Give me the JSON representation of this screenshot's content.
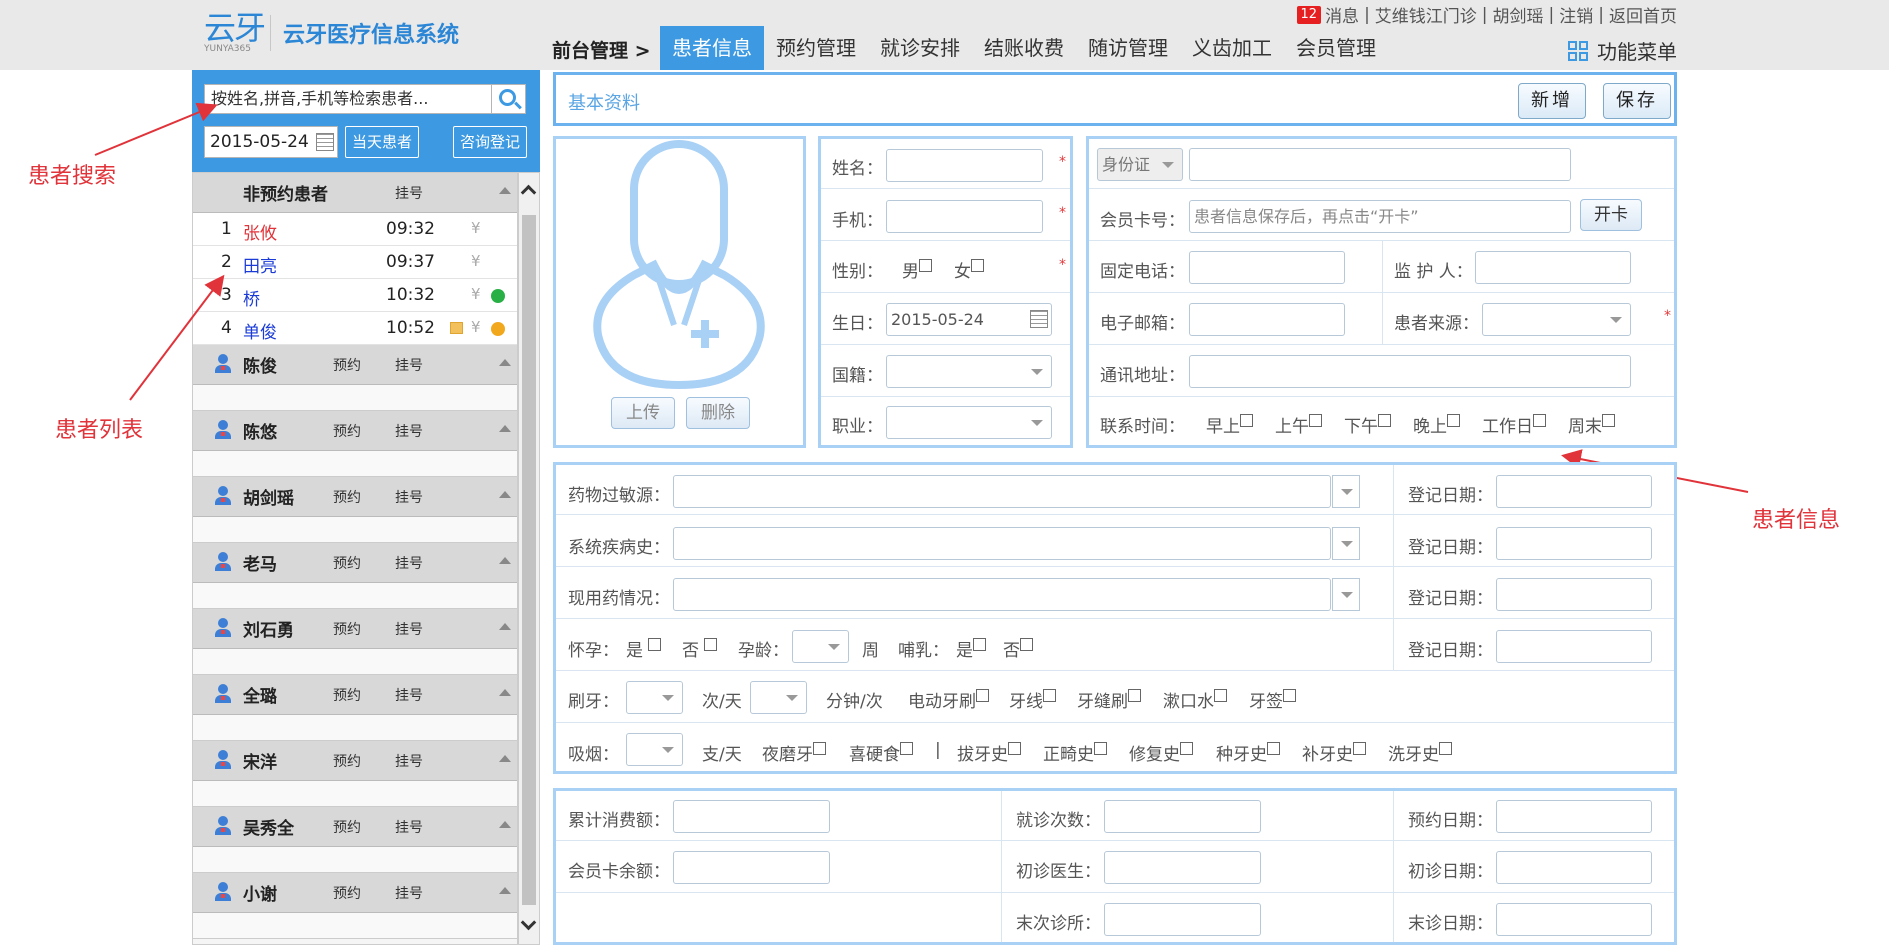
{
  "header": {
    "logo_glyph": "云牙",
    "logo_sub": "YUNYA365",
    "app_title": "云牙医疗信息系统",
    "msg_count": "12",
    "links": [
      "消息",
      "艾维钱江门诊",
      "胡剑瑶",
      "注销",
      "返回首页"
    ],
    "breadcrumb": "前台管理 >",
    "tabs": [
      "患者信息",
      "预约管理",
      "就诊安排",
      "结账收费",
      "随访管理",
      "义齿加工",
      "会员管理"
    ],
    "active_tab": "患者信息",
    "function_menu": "功能菜单"
  },
  "sidebar": {
    "search_placeholder": "按姓名,拼音,手机等检索患者...",
    "date": "2015-05-24",
    "btn_today": "当天患者",
    "btn_consult": "咨询登记",
    "nonappt_title": "非预约患者",
    "nonappt_tag": "挂号",
    "patients": [
      {
        "num": "1",
        "name": "张攸",
        "time": "09:32",
        "color": "#e0333a",
        "dot": ""
      },
      {
        "num": "2",
        "name": "田亮",
        "time": "09:37",
        "color": "#1a3bd6",
        "dot": ""
      },
      {
        "num": "3",
        "name": "桥",
        "time": "10:32",
        "color": "#1a3bd6",
        "dot": "#28b046"
      },
      {
        "num": "4",
        "name": "单俊",
        "time": "10:52",
        "color": "#1a3bd6",
        "dot": "#f2a81d"
      }
    ],
    "yen": "¥",
    "doctors": [
      "陈俊",
      "陈悠",
      "胡剑瑶",
      "老马",
      "刘石勇",
      "全璐",
      "宋洋",
      "吴秀全",
      "小谢"
    ],
    "tag_appt": "预约",
    "tag_reg": "挂号"
  },
  "annotations": {
    "search": "患者搜索",
    "list": "患者列表",
    "info": "患者信息"
  },
  "basic": {
    "title": "基本资料",
    "btn_new": "新增",
    "btn_save": "保存"
  },
  "photo": {
    "upload": "上传",
    "delete": "删除"
  },
  "personal": {
    "name": "姓名：",
    "phone": "手机：",
    "gender": "性别：",
    "male": "男",
    "female": "女",
    "birthday": "生日：",
    "birthday_value": "2015-05-24",
    "nationality": "国籍：",
    "occupation": "职业："
  },
  "contact": {
    "id_type": "身份证",
    "member_card": "会员卡号：",
    "member_card_placeholder": "患者信息保存后，再点击“开卡”",
    "open_card": "开卡",
    "landline": "固定电话：",
    "guardian": "监 护 人：",
    "email": "电子邮箱：",
    "source": "患者来源：",
    "address": "通讯地址：",
    "contact_time": "联系时间：",
    "times": [
      "早上",
      "上午",
      "下午",
      "晚上",
      "工作日",
      "周末"
    ]
  },
  "medical": {
    "allergy": "药物过敏源：",
    "history": "系统疾病史：",
    "current_med": "现用药情况：",
    "reg_date": "登记日期：",
    "pregnant": "怀孕：",
    "yes": "是",
    "no": "否",
    "preg_week": "孕龄：",
    "week": "周",
    "lactation": "哺乳：",
    "brush": "刷牙：",
    "times_unit": "次/天",
    "minutes_unit": "分钟/次",
    "brush_tools": [
      "电动牙刷",
      "牙线",
      "牙缝刷",
      "漱口水",
      "牙签"
    ],
    "smoke": "吸烟：",
    "per_day": "支/天",
    "habits_a": [
      "夜磨牙",
      "喜硬食"
    ],
    "divider": "|",
    "habits_b": [
      "拔牙史",
      "正畸史",
      "修复史",
      "种牙史",
      "补牙史",
      "洗牙史"
    ]
  },
  "stats": {
    "total_spend": "累计消费额：",
    "visits": "就诊次数：",
    "appt_date": "预约日期：",
    "card_balance": "会员卡余额：",
    "first_doctor": "初诊医生：",
    "first_date": "初诊日期：",
    "last_clinic": "末次诊所：",
    "last_date": "末诊日期："
  }
}
